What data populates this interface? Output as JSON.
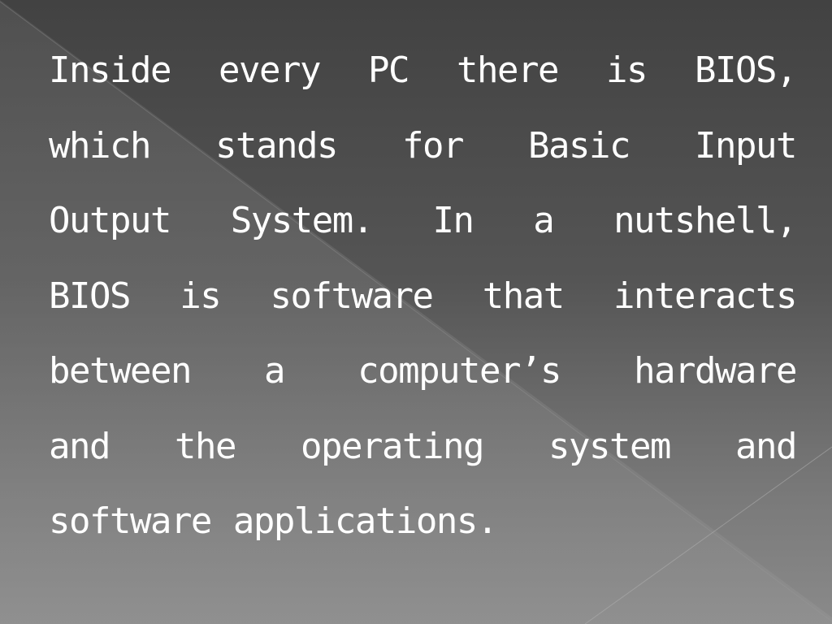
{
  "slide": {
    "colors": {
      "text": "#ffffff",
      "background_top": "#424242",
      "background_bottom": "#8a8a8a"
    },
    "paragraph": {
      "full_text": "Inside every PC there is BIOS, which stands for Basic Input Output System.  In a nutshell, BIOS is software that interacts between a computer’s hardware and the operating system and software applications.",
      "lines": [
        [
          "Inside",
          "every",
          "PC",
          "there",
          "is",
          "BIOS,"
        ],
        [
          "which",
          "stands",
          "for",
          "Basic",
          "Input"
        ],
        [
          "Output",
          "System.",
          "In",
          "a",
          "nutshell,"
        ],
        [
          "BIOS",
          "is",
          "software",
          "that",
          "interacts"
        ],
        [
          "between",
          "a",
          "computer’s",
          "hardware"
        ],
        [
          "and",
          "the",
          "operating",
          "system",
          "and"
        ],
        [
          "software",
          "applications."
        ]
      ]
    }
  }
}
